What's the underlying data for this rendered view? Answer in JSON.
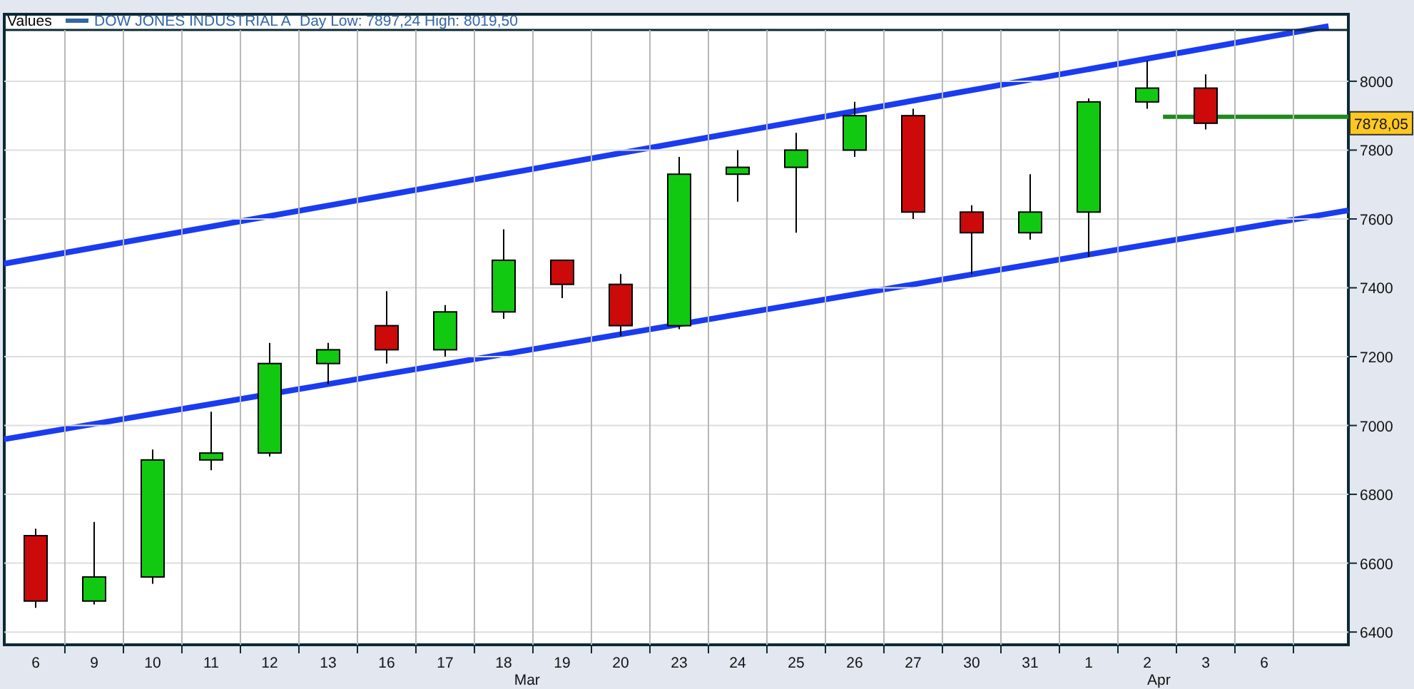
{
  "chart": {
    "legend_label": "Values",
    "day_range": "Day Low: 7897,24 High: 8019,50",
    "last_price": "7878,05",
    "months": [
      "Mar",
      "Apr"
    ],
    "chart_data": {
      "type": "candlestick",
      "title": "DOW JONES INDUSTRIAL A",
      "categories": [
        "6",
        "9",
        "10",
        "11",
        "12",
        "13",
        "16",
        "17",
        "18",
        "19",
        "20",
        "23",
        "24",
        "25",
        "26",
        "27",
        "30",
        "31",
        "1",
        "2",
        "3",
        "6"
      ],
      "ylim": [
        6363,
        8149
      ],
      "yticks": [
        6400,
        6600,
        6800,
        7000,
        7200,
        7400,
        7600,
        7800,
        8000
      ],
      "ohlc": [
        [
          6680,
          6700,
          6470,
          6490
        ],
        [
          6490,
          6720,
          6480,
          6560
        ],
        [
          6560,
          6930,
          6540,
          6900
        ],
        [
          6900,
          7040,
          6870,
          6920
        ],
        [
          6920,
          7240,
          6910,
          7180
        ],
        [
          7180,
          7240,
          7120,
          7220
        ],
        [
          7290,
          7390,
          7180,
          7220
        ],
        [
          7220,
          7350,
          7200,
          7330
        ],
        [
          7330,
          7570,
          7310,
          7480
        ],
        [
          7480,
          7480,
          7370,
          7410
        ],
        [
          7410,
          7440,
          7260,
          7290
        ],
        [
          7290,
          7780,
          7280,
          7730
        ],
        [
          7730,
          7800,
          7650,
          7750
        ],
        [
          7750,
          7850,
          7560,
          7800
        ],
        [
          7800,
          7940,
          7780,
          7900
        ],
        [
          7900,
          7920,
          7600,
          7620
        ],
        [
          7620,
          7640,
          7440,
          7560
        ],
        [
          7560,
          7730,
          7540,
          7620
        ],
        [
          7620,
          7950,
          7490,
          7940
        ],
        [
          7940,
          8060,
          7920,
          7980
        ],
        [
          7980,
          8020,
          7860,
          7878
        ],
        null
      ],
      "grid": true
    }
  }
}
